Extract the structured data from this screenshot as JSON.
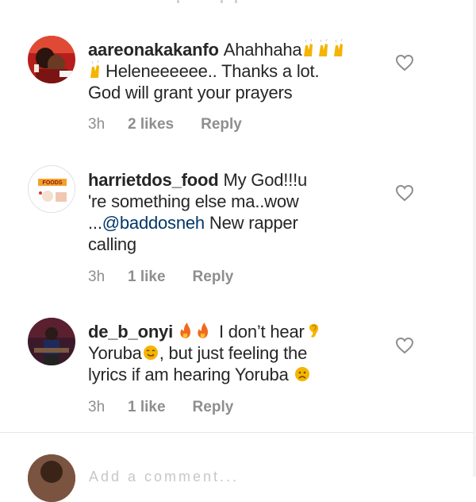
{
  "comments": [
    {
      "username": "aareonakakanfo",
      "text_1": "Ahahhaha",
      "text_2": "Heleneeeeee.. Thanks a lot.",
      "text_3": "God will grant your prayers",
      "time": "3h",
      "likes": "2 likes",
      "reply": "Reply",
      "avatar_icon": "profile-photo-icon"
    },
    {
      "username": "harrietdos_food",
      "text_1": "My God!!!u",
      "text_2": "'re something else ma..wow",
      "text_3_prefix": "...",
      "mention": "@baddosneh",
      "text_3_suffix": " New rapper",
      "text_4": "calling",
      "time": "3h",
      "likes": "1 like",
      "reply": "Reply",
      "avatar_logo_text": "HARRIETDOS FOODS"
    },
    {
      "username": "de_b_onyi",
      "text_1": "I don’t hear",
      "text_2": "Yoruba",
      "text_2_suffix": ", but just feeling the",
      "text_3": "lyrics if am hearing Yoruba",
      "time": "3h",
      "likes": "1 like",
      "reply": "Reply",
      "avatar_icon": "profile-photo-icon"
    }
  ],
  "bottom_bar": {
    "placeholder": "Add a comment..."
  },
  "colors": {
    "text": "#262626",
    "meta": "#8e8e8e",
    "mention": "#00376b",
    "heart": "#8e8e8e"
  }
}
